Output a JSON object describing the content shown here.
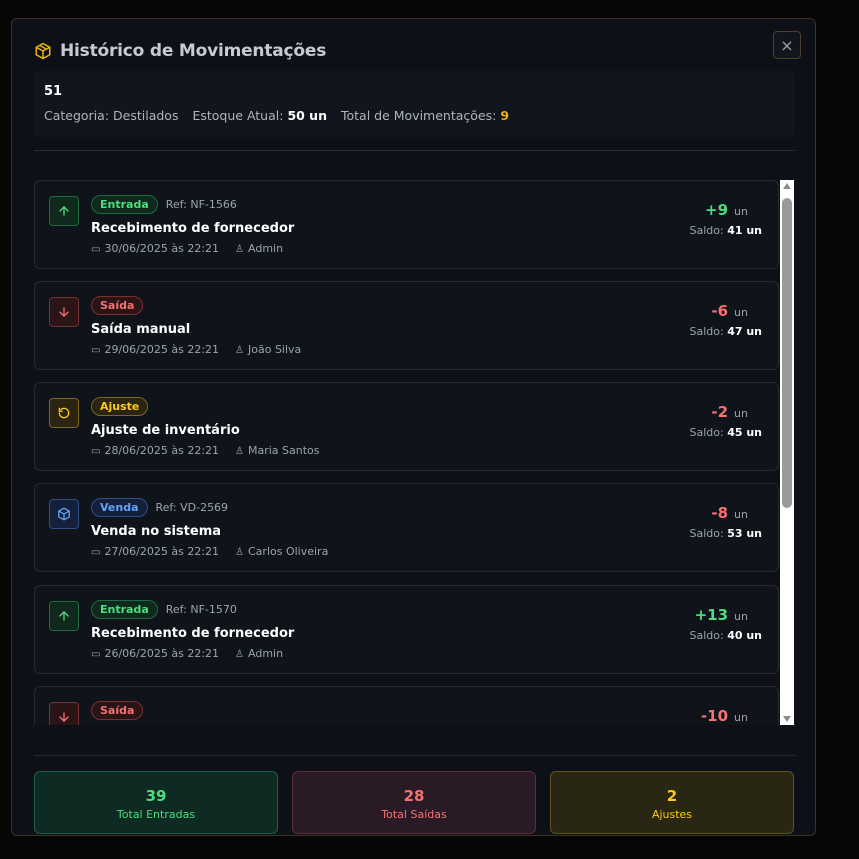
{
  "modal": {
    "title": "Histórico de Movimentações",
    "close_label": "×"
  },
  "product": {
    "name": "51",
    "category_label": "Categoria:",
    "category": "Destilados",
    "stock_label": "Estoque Atual:",
    "stock": "50 un",
    "total_label": "Total de Movimentações:",
    "total": "9"
  },
  "movements": [
    {
      "type": "Entrada",
      "ref": "Ref: NF-1566",
      "desc": "Recebimento de fornecedor",
      "date": "30/06/2025 às 22:21",
      "user": "Admin",
      "qty": "+9",
      "unit": "un",
      "saldo_label": "Saldo:",
      "saldo": "41 un"
    },
    {
      "type": "Saída",
      "ref": "",
      "desc": "Saída manual",
      "date": "29/06/2025 às 22:21",
      "user": "João Silva",
      "qty": "-6",
      "unit": "un",
      "saldo_label": "Saldo:",
      "saldo": "47 un"
    },
    {
      "type": "Ajuste",
      "ref": "",
      "desc": "Ajuste de inventário",
      "date": "28/06/2025 às 22:21",
      "user": "Maria Santos",
      "qty": "-2",
      "unit": "un",
      "saldo_label": "Saldo:",
      "saldo": "45 un"
    },
    {
      "type": "Venda",
      "ref": "Ref: VD-2569",
      "desc": "Venda no sistema",
      "date": "27/06/2025 às 22:21",
      "user": "Carlos Oliveira",
      "qty": "-8",
      "unit": "un",
      "saldo_label": "Saldo:",
      "saldo": "53 un"
    },
    {
      "type": "Entrada",
      "ref": "Ref: NF-1570",
      "desc": "Recebimento de fornecedor",
      "date": "26/06/2025 às 22:21",
      "user": "Admin",
      "qty": "+13",
      "unit": "un",
      "saldo_label": "Saldo:",
      "saldo": "40 un"
    },
    {
      "type": "Saída",
      "ref": "",
      "desc": "",
      "date": "",
      "user": "",
      "qty": "-10",
      "unit": "un",
      "saldo_label": "",
      "saldo": ""
    }
  ],
  "summary": {
    "entradas_value": "39",
    "entradas_label": "Total Entradas",
    "saidas_value": "28",
    "saidas_label": "Total Saídas",
    "ajustes_value": "2",
    "ajustes_label": "Ajustes"
  },
  "colors": {
    "accent": "#eab308",
    "entrada": "#4ade80",
    "saida": "#f87171",
    "ajuste": "#facc15",
    "venda": "#60a5fa"
  },
  "icons": {
    "header": "package-icon",
    "entrada": "arrow-up-icon",
    "saida": "arrow-down-icon",
    "ajuste": "rotate-icon",
    "venda": "package-icon",
    "date": "calendar-icon",
    "user": "user-icon"
  }
}
